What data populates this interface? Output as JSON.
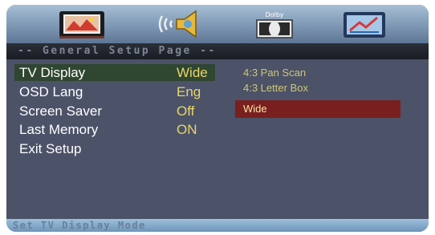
{
  "header": {
    "icons": [
      "general-setup-icon",
      "audio-setup-icon",
      "dolby-setup-icon",
      "preference-setup-icon"
    ],
    "dolby_label": "Dolby",
    "title": "-- General Setup Page --"
  },
  "menu": {
    "items": [
      {
        "label": "TV Display",
        "value": "Wide"
      },
      {
        "label": "OSD Lang",
        "value": "Eng"
      },
      {
        "label": "Screen Saver",
        "value": "Off"
      },
      {
        "label": "Last Memory",
        "value": "ON"
      },
      {
        "label": "Exit Setup",
        "value": ""
      }
    ],
    "selected_index": 0
  },
  "options": {
    "items": [
      "4:3 Pan Scan",
      "4:3 Letter Box",
      "Wide"
    ],
    "selected_index": 2
  },
  "status": {
    "text": "Set TV Display Mode"
  },
  "colors": {
    "selected_menu_bg": "#2f4630",
    "selected_option_bg": "#7a1f1f",
    "value_text": "#e7d66a",
    "panel_bg": "#4c5268"
  }
}
